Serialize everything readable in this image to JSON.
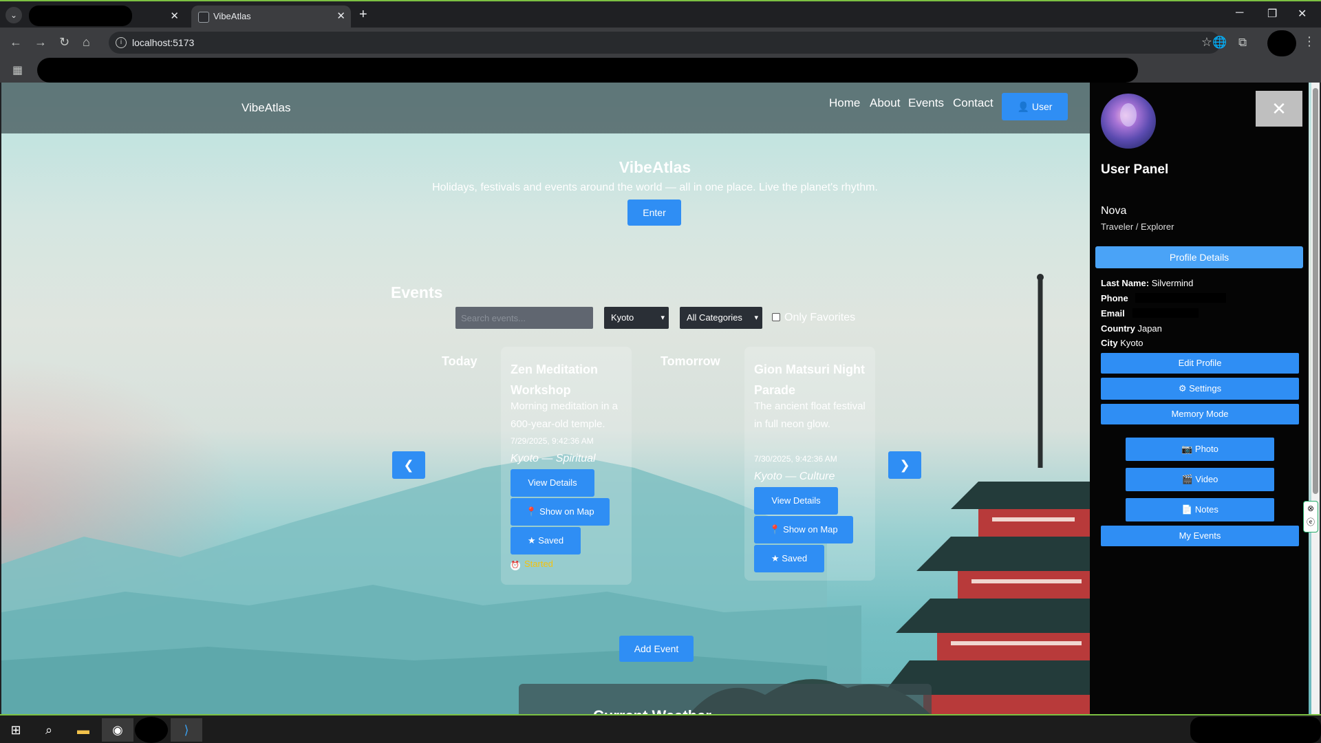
{
  "browser": {
    "active_tab_title": "VibeAtlas",
    "url": "localhost:5173"
  },
  "site": {
    "brand": "VibeAtlas",
    "nav": [
      "Home",
      "About",
      "Events",
      "Contact"
    ],
    "user_button": "User"
  },
  "hero": {
    "title": "VibeAtlas",
    "subtitle": "Holidays, festivals and events around the world — all in one place. Live the planet's rhythm.",
    "enter_label": "Enter"
  },
  "events": {
    "heading": "Events",
    "search_placeholder": "Search events...",
    "city_filter": "Kyoto",
    "category_filter": "All Categories",
    "favorites_label": "Only Favorites",
    "prev_label": "❮",
    "next_label": "❯",
    "days": [
      {
        "label": "Today",
        "title": "Zen Meditation Workshop",
        "description": "Morning meditation in a 600-year-old temple.",
        "date": "7/29/2025, 9:42:36 AM",
        "location": "Kyoto — Spiritual",
        "view_label": "View Details",
        "map_label": "📍 Show on Map",
        "saved_label": "★ Saved",
        "status": "Started"
      },
      {
        "label": "Tomorrow",
        "title": "Gion Matsuri Night Parade",
        "description": "The ancient float festival in full neon glow.",
        "date": "7/30/2025, 9:42:36 AM",
        "location": "Kyoto — Culture",
        "view_label": "View Details",
        "map_label": "📍 Show on Map",
        "saved_label": "★ Saved"
      }
    ],
    "add_event_label": "Add Event"
  },
  "bottom_section": {
    "title": "Current Weather"
  },
  "user_panel": {
    "heading": "User Panel",
    "name": "Nova",
    "role": "Traveler / Explorer",
    "profile_details_label": "Profile Details",
    "fields": [
      {
        "label": "Last Name:",
        "value": "Silvermind"
      },
      {
        "label": "Phone",
        "value": ""
      },
      {
        "label": "Email",
        "value": ""
      },
      {
        "label": "Country",
        "value": "Japan"
      },
      {
        "label": "City",
        "value": "Kyoto"
      }
    ],
    "edit_profile_label": "Edit Profile",
    "settings_label": "⚙ Settings",
    "memory_mode_label": "Memory Mode",
    "photo_label": "📷 Photo",
    "video_label": "🎬 Video",
    "notes_label": "📄 Notes",
    "my_events_label": "My Events",
    "close_label": "✕"
  },
  "colors": {
    "accent": "#2f8ef4",
    "panel_bg": "#050505",
    "status_started": "#f4c20d"
  }
}
